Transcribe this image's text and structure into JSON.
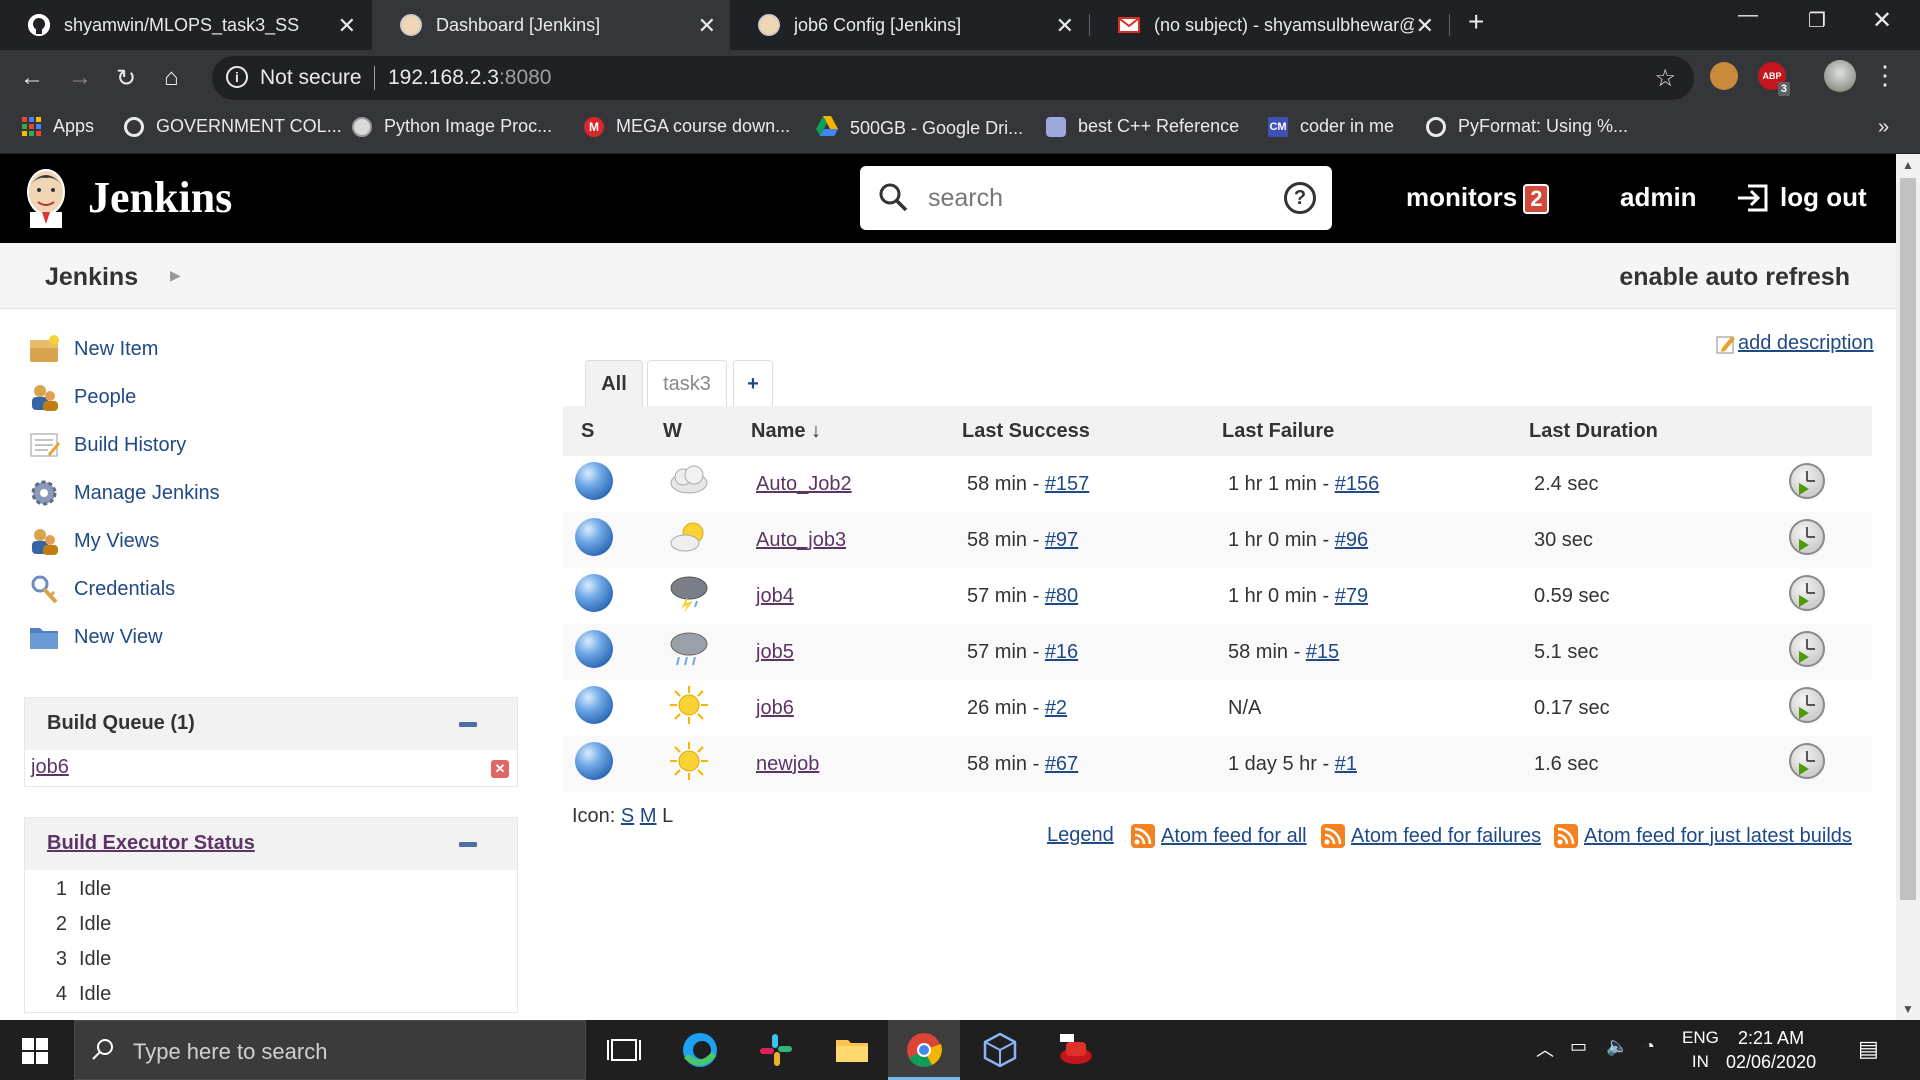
{
  "browser": {
    "tabs": [
      {
        "title": "shyamwin/MLOPS_task3_SS",
        "icon": "github-icon",
        "active": false
      },
      {
        "title": "Dashboard [Jenkins]",
        "icon": "jenkins-icon",
        "active": true
      },
      {
        "title": "job6 Config [Jenkins]",
        "icon": "jenkins-icon",
        "active": false
      },
      {
        "title": "(no subject) - shyamsulbhewar@",
        "icon": "gmail-icon",
        "active": false
      }
    ],
    "omnibox": {
      "security_label": "Not secure",
      "host": "192.168.2.3",
      "port": ":8080"
    },
    "extensions": {
      "abp_badge": "3",
      "abp_label": "ABP"
    },
    "bookmarks": [
      {
        "label": "Apps",
        "icon": "apps-grid-icon",
        "color": "#e8453c"
      },
      {
        "label": "GOVERNMENT COL...",
        "icon": "chrome-globe-icon",
        "color": "#e8eaed"
      },
      {
        "label": "Python Image Proc...",
        "icon": "site-icon",
        "color": "#d9d9d9"
      },
      {
        "label": "MEGA course down...",
        "icon": "mega-icon",
        "color": "#d9272e"
      },
      {
        "label": "500GB - Google Dri...",
        "icon": "google-drive-icon",
        "color": "#f4b400"
      },
      {
        "label": "best  C++ Reference",
        "icon": "cpp-reference-icon",
        "color": "#9fa8da"
      },
      {
        "label": "coder in me",
        "icon": "cm-icon",
        "color": "#3f51b5"
      },
      {
        "label": "PyFormat: Using %...",
        "icon": "chrome-globe-icon",
        "color": "#e8eaed"
      }
    ]
  },
  "jenkins": {
    "title": "Jenkins",
    "search_placeholder": "search",
    "monitors_label": "monitors",
    "monitors_count": "2",
    "user": "admin",
    "logout_label": "log out",
    "breadcrumb_root": "Jenkins",
    "auto_refresh": "enable auto refresh",
    "add_description": "add description",
    "side_links": [
      {
        "label": "New Item",
        "icon": "new-item-icon"
      },
      {
        "label": "People",
        "icon": "people-icon"
      },
      {
        "label": "Build History",
        "icon": "build-history-icon"
      },
      {
        "label": "Manage Jenkins",
        "icon": "gear-icon"
      },
      {
        "label": "My Views",
        "icon": "my-views-icon"
      },
      {
        "label": "Credentials",
        "icon": "credentials-icon"
      },
      {
        "label": "New View",
        "icon": "folder-icon"
      }
    ],
    "build_queue": {
      "title": "Build Queue (1)",
      "items": [
        "job6"
      ]
    },
    "executor_status": {
      "title": "Build Executor Status",
      "executors": [
        {
          "num": "1",
          "state": "Idle"
        },
        {
          "num": "2",
          "state": "Idle"
        },
        {
          "num": "3",
          "state": "Idle"
        },
        {
          "num": "4",
          "state": "Idle"
        }
      ]
    },
    "view_tabs": {
      "all": "All",
      "task3": "task3",
      "add": "+"
    },
    "table_headers": {
      "s": "S",
      "w": "W",
      "name": "Name",
      "sort": "↓",
      "last_success": "Last Success",
      "last_failure": "Last Failure",
      "last_duration": "Last Duration"
    },
    "jobs": [
      {
        "name": "Auto_Job2",
        "weather": "cloudy",
        "success_time": "58 min - ",
        "success_build": "#157",
        "failure_time": "1 hr 1 min - ",
        "failure_build": "#156",
        "duration": "2.4 sec"
      },
      {
        "name": "Auto_job3",
        "weather": "partly-sunny",
        "success_time": "58 min - ",
        "success_build": "#97",
        "failure_time": "1 hr 0 min - ",
        "failure_build": "#96",
        "duration": "30 sec"
      },
      {
        "name": "job4",
        "weather": "thunderstorm",
        "success_time": "57 min - ",
        "success_build": "#80",
        "failure_time": "1 hr 0 min - ",
        "failure_build": "#79",
        "duration": "0.59 sec"
      },
      {
        "name": "job5",
        "weather": "rain",
        "success_time": "57 min - ",
        "success_build": "#16",
        "failure_time": "58 min - ",
        "failure_build": "#15",
        "duration": "5.1 sec"
      },
      {
        "name": "job6",
        "weather": "sunny",
        "success_time": "26 min - ",
        "success_build": "#2",
        "failure_time": "N/A",
        "failure_build": "",
        "duration": "0.17 sec"
      },
      {
        "name": "newjob",
        "weather": "sunny",
        "success_time": "58 min - ",
        "success_build": "#67",
        "failure_time": "1 day 5 hr - ",
        "failure_build": "#1",
        "duration": "1.6 sec"
      }
    ],
    "icon_size": {
      "label": "Icon: ",
      "s": "S",
      "m": "M",
      "l": "L"
    },
    "legend": "Legend",
    "feeds": {
      "all": "Atom feed for all",
      "failures": "Atom feed for failures",
      "latest": "Atom feed for just latest builds"
    }
  },
  "taskbar": {
    "search_placeholder": "Type here to search",
    "lang_top": "ENG",
    "lang_bottom": "IN",
    "time": "2:21 AM",
    "date": "02/06/2020"
  }
}
